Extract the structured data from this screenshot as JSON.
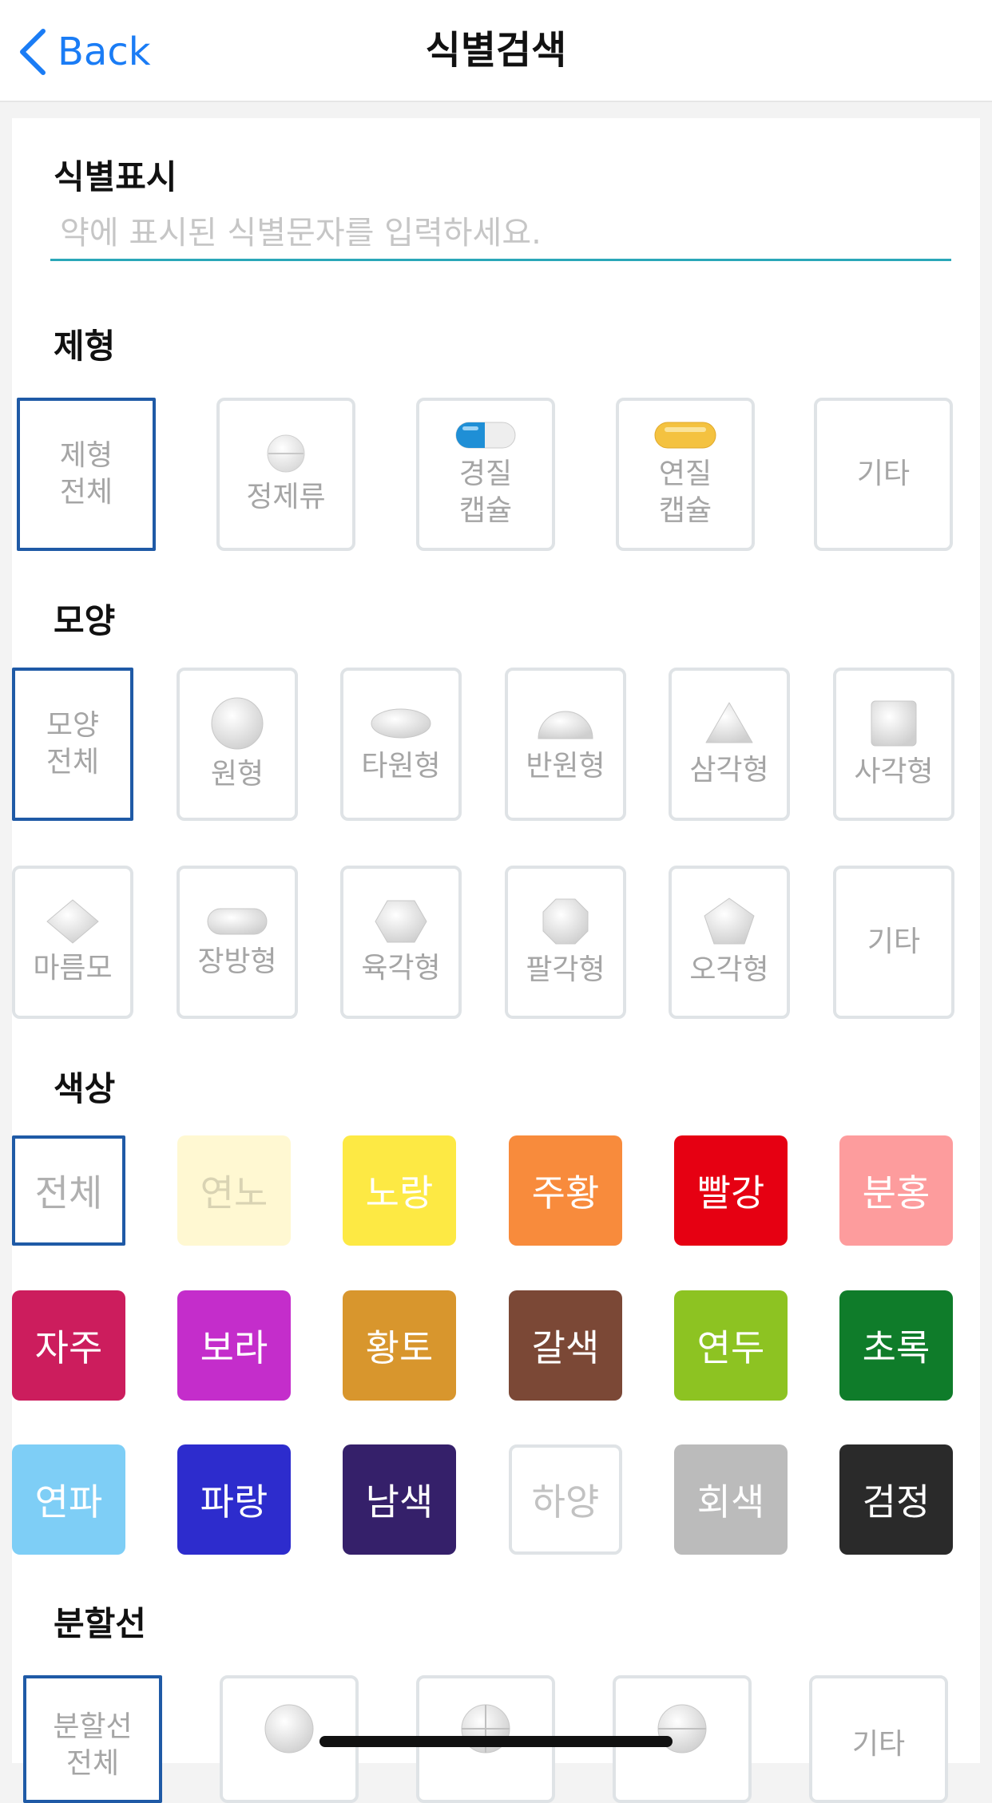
{
  "nav": {
    "back_label": "Back",
    "title": "식별검색"
  },
  "marking": {
    "label": "식별표시",
    "placeholder": "약에 표시된 식별문자를 입력하세요.",
    "value": ""
  },
  "form": {
    "label": "제형",
    "items": [
      {
        "label": "제형\n전체",
        "icon": "none",
        "selected": true
      },
      {
        "label": "정제류",
        "icon": "tablet-icon",
        "selected": false
      },
      {
        "label": "경질\n캡슐",
        "icon": "hard-capsule-icon",
        "selected": false
      },
      {
        "label": "연질\n캡슐",
        "icon": "soft-capsule-icon",
        "selected": false
      },
      {
        "label": "기타",
        "icon": "none",
        "selected": false
      }
    ]
  },
  "shape": {
    "label": "모양",
    "items": [
      {
        "label": "모양\n전체",
        "icon": "none",
        "selected": true
      },
      {
        "label": "원형",
        "icon": "circle-pill-icon"
      },
      {
        "label": "타원형",
        "icon": "oval-pill-icon"
      },
      {
        "label": "반원형",
        "icon": "semicircle-pill-icon"
      },
      {
        "label": "삼각형",
        "icon": "triangle-pill-icon"
      },
      {
        "label": "사각형",
        "icon": "square-pill-icon"
      },
      {
        "label": "마름모",
        "icon": "diamond-pill-icon"
      },
      {
        "label": "장방형",
        "icon": "oblong-pill-icon"
      },
      {
        "label": "육각형",
        "icon": "hexagon-pill-icon"
      },
      {
        "label": "팔각형",
        "icon": "octagon-pill-icon"
      },
      {
        "label": "오각형",
        "icon": "pentagon-pill-icon"
      },
      {
        "label": "기타",
        "icon": "none"
      }
    ]
  },
  "color": {
    "label": "색상",
    "items": [
      {
        "label": "전체",
        "color": "#ffffff",
        "selected": true
      },
      {
        "label": "연노",
        "color": "#fff8d2"
      },
      {
        "label": "노랑",
        "color": "#fde944"
      },
      {
        "label": "주황",
        "color": "#f88b3c"
      },
      {
        "label": "빨강",
        "color": "#e60012"
      },
      {
        "label": "분홍",
        "color": "#fd9c9d"
      },
      {
        "label": "자주",
        "color": "#cc1d5d"
      },
      {
        "label": "보라",
        "color": "#c42dcb"
      },
      {
        "label": "황토",
        "color": "#d8962d"
      },
      {
        "label": "갈색",
        "color": "#7b4836"
      },
      {
        "label": "연두",
        "color": "#8dc322"
      },
      {
        "label": "초록",
        "color": "#0f7c2a"
      },
      {
        "label": "연파",
        "color": "#7ecef6"
      },
      {
        "label": "파랑",
        "color": "#2d2ccd"
      },
      {
        "label": "남색",
        "color": "#35206a"
      },
      {
        "label": "하양",
        "color": "#ffffff"
      },
      {
        "label": "회색",
        "color": "#bbbbbb"
      },
      {
        "label": "검정",
        "color": "#2a2a2a"
      }
    ]
  },
  "divider": {
    "label": "분할선",
    "items": [
      {
        "label": "분할선\n전체",
        "icon": "none",
        "selected": true
      },
      {
        "label": "",
        "icon": "no-line-pill-icon"
      },
      {
        "label": "",
        "icon": "cross-line-pill-icon"
      },
      {
        "label": "",
        "icon": "single-line-pill-icon"
      },
      {
        "label": "기타",
        "icon": "none"
      }
    ]
  }
}
